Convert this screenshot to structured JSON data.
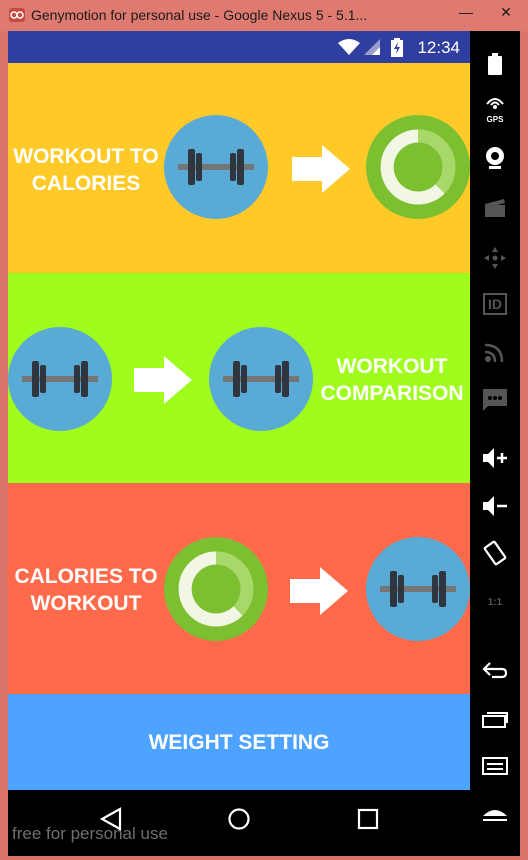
{
  "window": {
    "title": "Genymotion for personal use - Google Nexus 5 - 5.1...",
    "minimize": "—",
    "close": "✕"
  },
  "status_bar": {
    "time": "12:34",
    "icons": [
      "wifi-icon",
      "signal-icon",
      "battery-charging-icon"
    ],
    "color": "#303f9f"
  },
  "panels": [
    {
      "id": "workout-to-calories",
      "label_line1": "WORKOUT TO",
      "label_line2": "CALORIES",
      "background": "#ffca28",
      "icons": [
        "dumbbell-icon",
        "arrow-right-icon",
        "calories-ring-icon"
      ]
    },
    {
      "id": "workout-comparison",
      "label_line1": "WORKOUT",
      "label_line2": "COMPARISON",
      "background": "#9ffc1c",
      "icons": [
        "dumbbell-icon",
        "arrow-right-icon",
        "dumbbell-icon"
      ]
    },
    {
      "id": "calories-to-workout",
      "label_line1": "CALORIES TO",
      "label_line2": "WORKOUT",
      "background": "#ff6b4a",
      "icons": [
        "calories-ring-icon",
        "arrow-right-icon",
        "dumbbell-icon"
      ]
    },
    {
      "id": "weight-setting",
      "label": "WEIGHT SETTING",
      "background": "#4da3ff"
    }
  ],
  "nav_bar": {
    "buttons": [
      "back-icon",
      "home-icon",
      "recents-icon"
    ]
  },
  "watermark": "free for personal use",
  "sidebar": {
    "buttons": [
      "battery-icon",
      "gps-icon",
      "webcam-icon",
      "clapper-icon",
      "dpad-icon",
      "id-icon",
      "cast-icon",
      "sms-icon",
      "volume-up-icon",
      "volume-down-icon",
      "rotate-icon",
      "scale-icon",
      "back-icon",
      "recents-icon",
      "menu-icon",
      "home-icon"
    ],
    "gps_text": "GPS",
    "id_text": "ID",
    "scale_text": "1:1"
  },
  "colors": {
    "dumbbell_circle": "#5aaad6",
    "calories_circle": "#7cc031",
    "arrow": "#ffffff"
  }
}
